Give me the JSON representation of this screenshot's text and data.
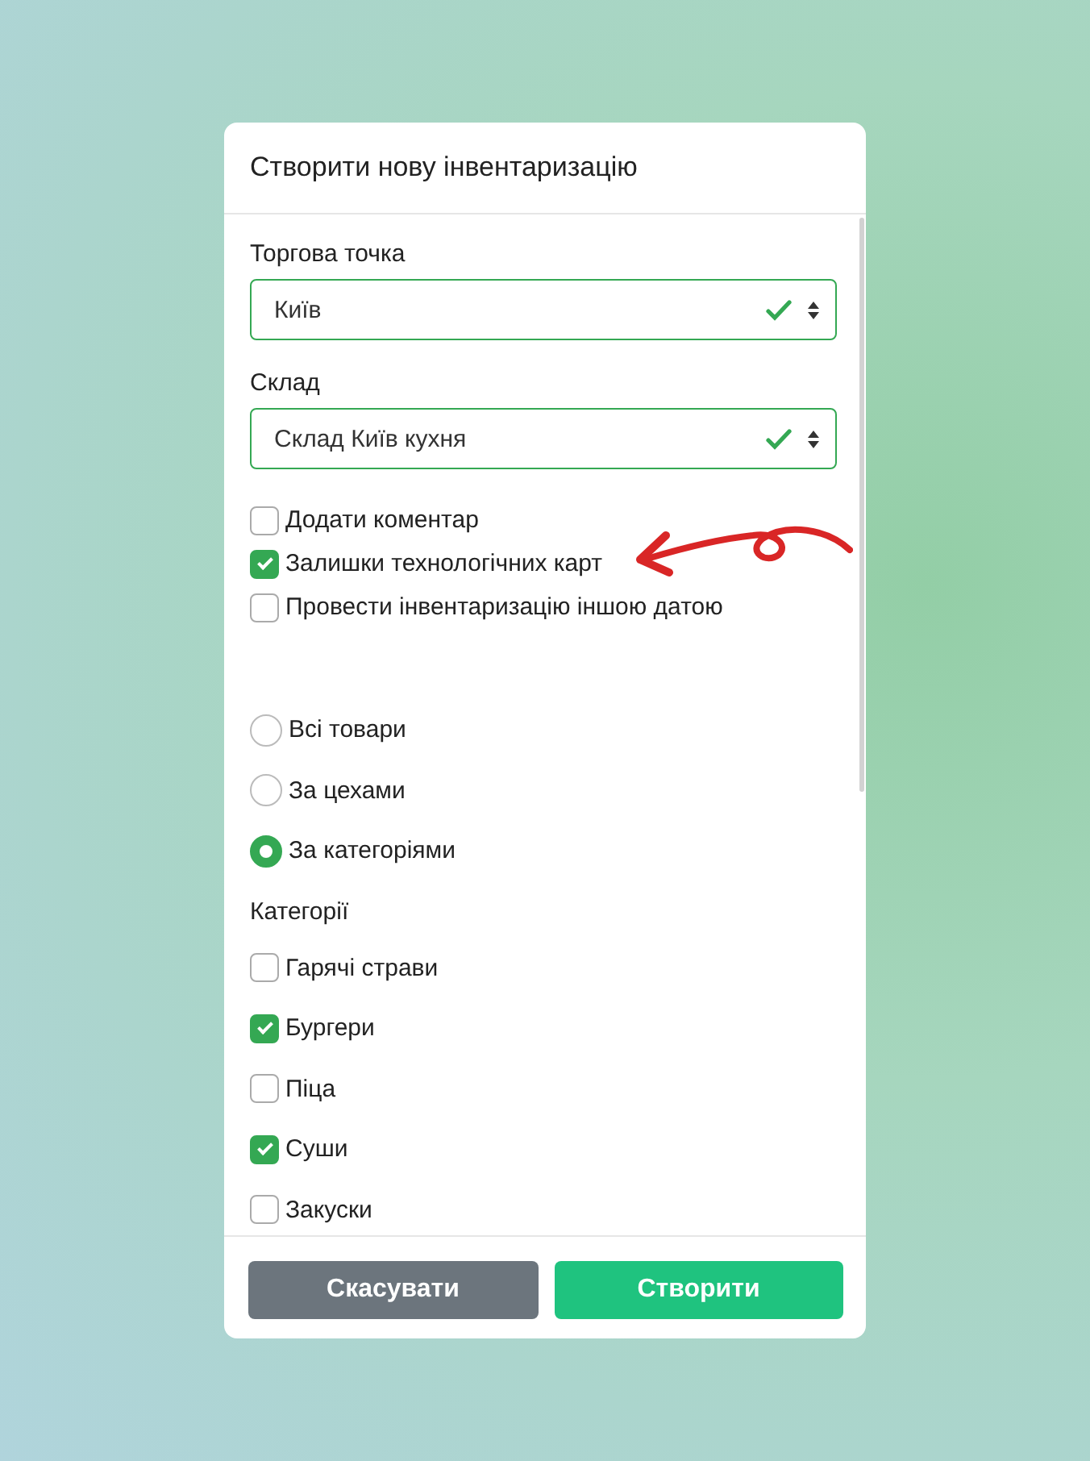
{
  "dialog": {
    "title": "Створити нову інвентаризацію"
  },
  "selects": [
    {
      "label": "Торгова точка",
      "value": "Київ",
      "valid": true
    },
    {
      "label": "Склад",
      "value": "Склад Київ кухня",
      "valid": true
    }
  ],
  "options": [
    {
      "label": "Додати коментар",
      "checked": false
    },
    {
      "label": "Залишки технологічних карт",
      "checked": true
    },
    {
      "label": "Провести інвентаризацію іншою датою",
      "checked": false
    }
  ],
  "scope": [
    {
      "label": "Всі товари",
      "selected": false
    },
    {
      "label": "За цехами",
      "selected": false
    },
    {
      "label": "За категоріями",
      "selected": true
    }
  ],
  "categories": {
    "title": "Категорії",
    "items": [
      {
        "label": "Гарячі страви",
        "checked": false
      },
      {
        "label": "Бургери",
        "checked": true
      },
      {
        "label": "Піца",
        "checked": false
      },
      {
        "label": "Суши",
        "checked": true
      },
      {
        "label": "Закуски",
        "checked": false
      }
    ]
  },
  "buttons": [
    {
      "label": "Скасувати",
      "kind": "secondary"
    },
    {
      "label": "Створити",
      "kind": "primary"
    }
  ]
}
